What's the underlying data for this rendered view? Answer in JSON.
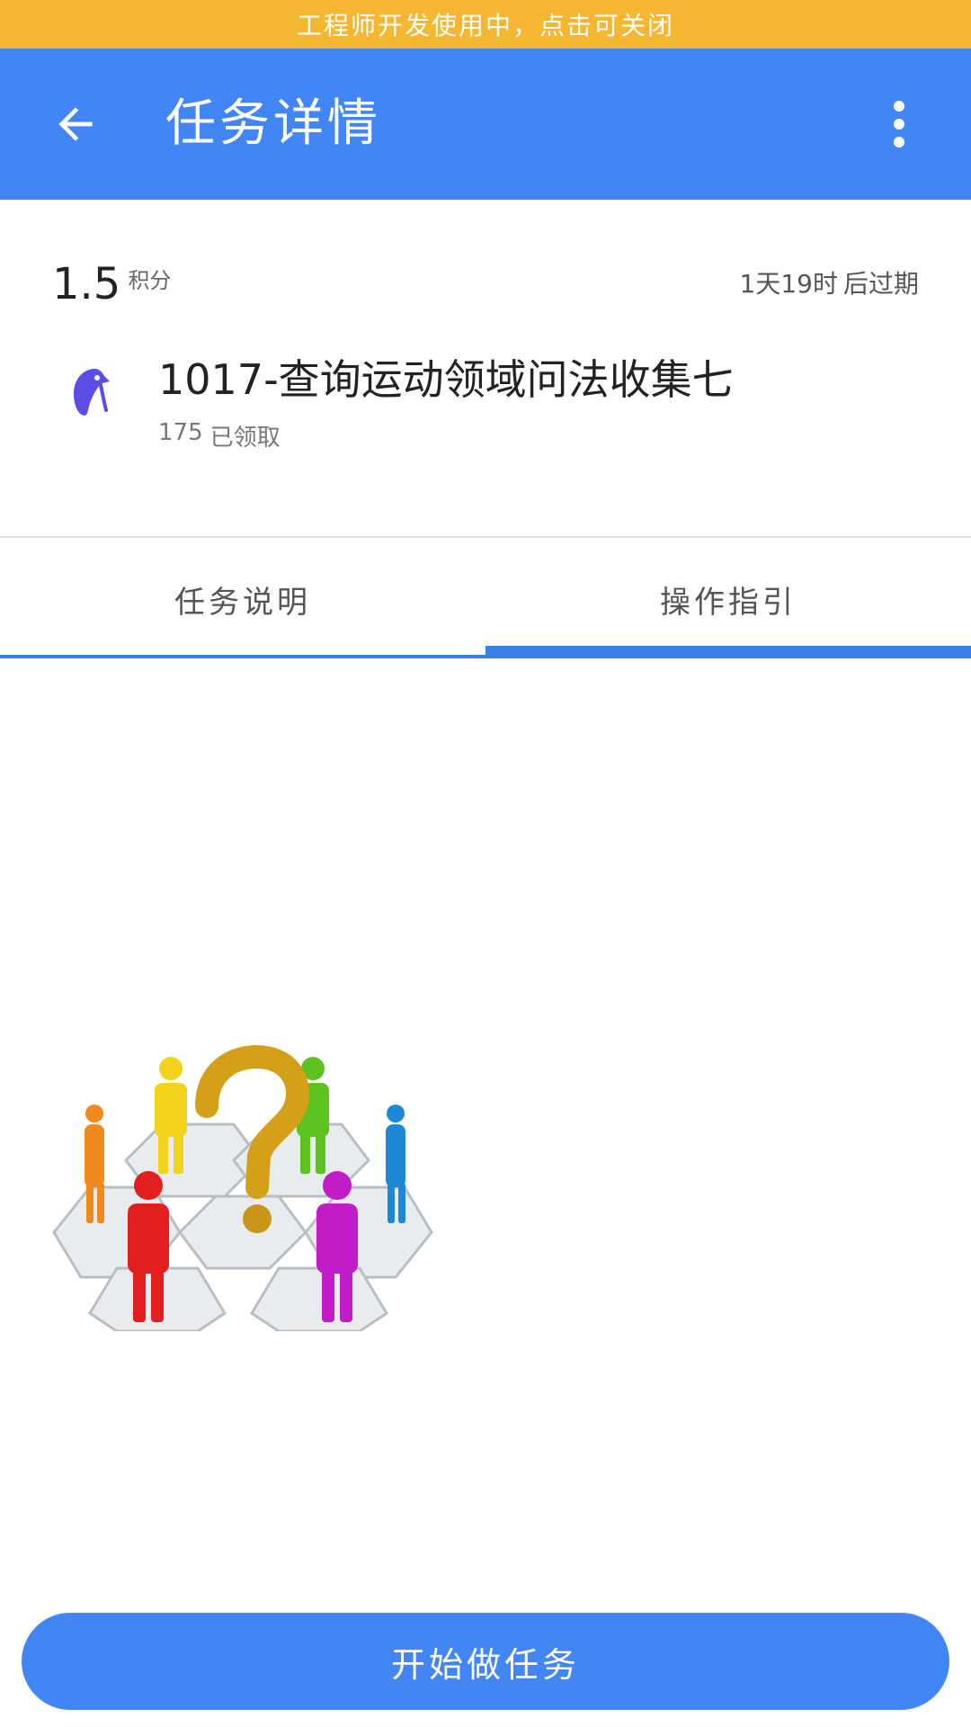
{
  "dev_banner": {
    "text": "工程师开发使用中，点击可关闭"
  },
  "appbar": {
    "title": "任务详情",
    "back_icon": "arrow-left-icon",
    "more_icon": "more-vertical-icon"
  },
  "task": {
    "points_value": "1.5",
    "points_unit": "积分",
    "expire_time": "1天19时",
    "expire_suffix": "后过期",
    "title": "1017-查询运动领域问法收集七",
    "claimed_count": "175",
    "claimed_label": "已领取",
    "icon": "penguin-icon",
    "icon_color": "#5B4CE6"
  },
  "tabs": [
    {
      "label": "任务说明"
    },
    {
      "label": "操作指引"
    }
  ],
  "illustration": {
    "icon": "people-question-illustration"
  },
  "actions": {
    "start_label": "开始做任务"
  },
  "colors": {
    "banner": "#F5B731",
    "primary": "#4285F4",
    "tab_indicator": "#3B82E6"
  }
}
